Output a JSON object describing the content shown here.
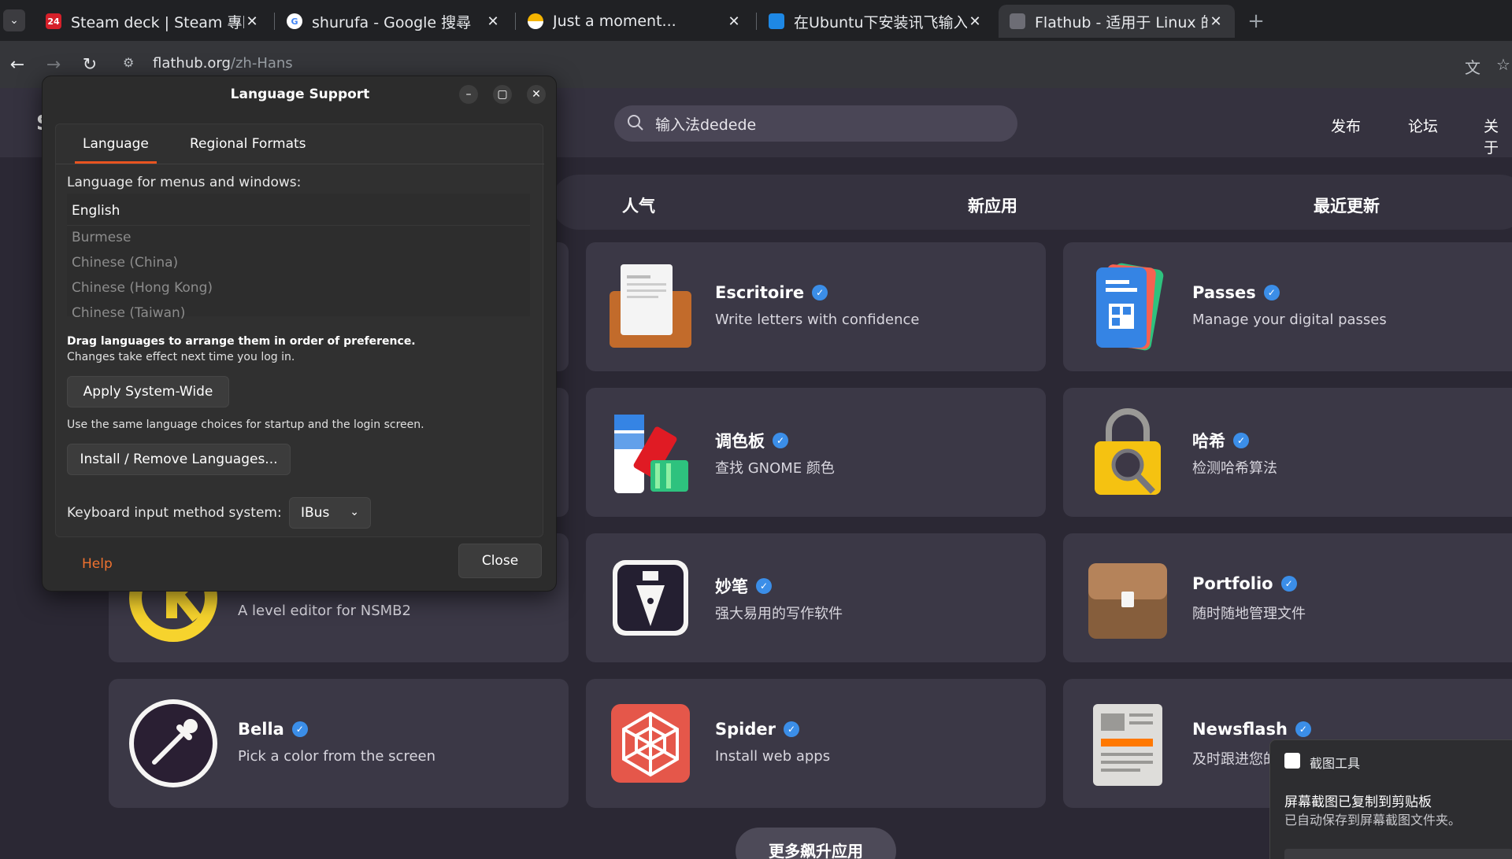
{
  "browser": {
    "tabs": [
      {
        "title": "Steam deck | Steam 專區",
        "favicon": "steam-24-icon",
        "active": false
      },
      {
        "title": "shurufa - Google 搜尋",
        "favicon": "google-icon",
        "active": false
      },
      {
        "title": "Just a moment...",
        "favicon": "cloudflare-icon",
        "active": false
      },
      {
        "title": "在Ubuntu下安装讯飞输入法",
        "favicon": "site-icon",
        "active": false
      },
      {
        "title": "Flathub - 适用于 Linux 的",
        "favicon": "flathub-icon",
        "active": true
      }
    ],
    "url_host": "flathub.org",
    "url_path": "/zh-Hans"
  },
  "flathub": {
    "search_value": "输入法dedede",
    "nav": [
      "发布",
      "论坛",
      "关于"
    ],
    "categories": [
      "人气",
      "新应用",
      "最近更新"
    ],
    "apps": [
      {
        "name": "Escritoire",
        "desc": "Write letters with confidence",
        "icon": "escritoire-icon"
      },
      {
        "name": "Passes",
        "desc": "Manage your digital passes",
        "icon": "passes-icon"
      },
      {
        "name": "调色板",
        "desc": "查找 GNOME 颜色",
        "icon": "palette-icon"
      },
      {
        "name": "哈希",
        "desc": "检测哈希算法",
        "icon": "hash-lock-icon"
      },
      {
        "name": "",
        "desc": "A level editor for NSMB2",
        "icon": "level-editor-icon"
      },
      {
        "name": "妙笔",
        "desc": "强大易用的写作软件",
        "icon": "fountain-pen-icon"
      },
      {
        "name": "Portfolio",
        "desc": "随时随地管理文件",
        "icon": "briefcase-icon"
      },
      {
        "name": "Bella",
        "desc": "Pick a color from the screen",
        "icon": "eyedropper-icon"
      },
      {
        "name": "Spider",
        "desc": "Install web apps",
        "icon": "spider-web-icon"
      },
      {
        "name": "Newsflash",
        "desc": "及时跟进您的",
        "icon": "newspaper-icon"
      }
    ],
    "more_button": "更多飙升应用"
  },
  "dialog": {
    "title": "Language Support",
    "tabs": [
      "Language",
      "Regional Formats"
    ],
    "menu_language_label": "Language for menus and windows:",
    "languages": [
      "English",
      "Burmese",
      "Chinese (China)",
      "Chinese (Hong Kong)",
      "Chinese (Taiwan)"
    ],
    "drag_hint": "Drag languages to arrange them in order of preference.",
    "changes_hint": "Changes take effect next time you log in.",
    "apply_button": "Apply System-Wide",
    "apply_hint": "Use the same language choices for startup and the login screen.",
    "install_button": "Install / Remove Languages...",
    "keyboard_label": "Keyboard input method system:",
    "keyboard_value": "IBus",
    "help": "Help",
    "close": "Close"
  },
  "toast": {
    "app": "截图工具",
    "title": "屏幕截图已复制到剪贴板",
    "body": "已自动保存到屏幕截图文件夹。"
  },
  "colors": {
    "accent_orange": "#e95420",
    "verified_blue": "#3b8ee8",
    "page_bg": "#2b2834"
  }
}
